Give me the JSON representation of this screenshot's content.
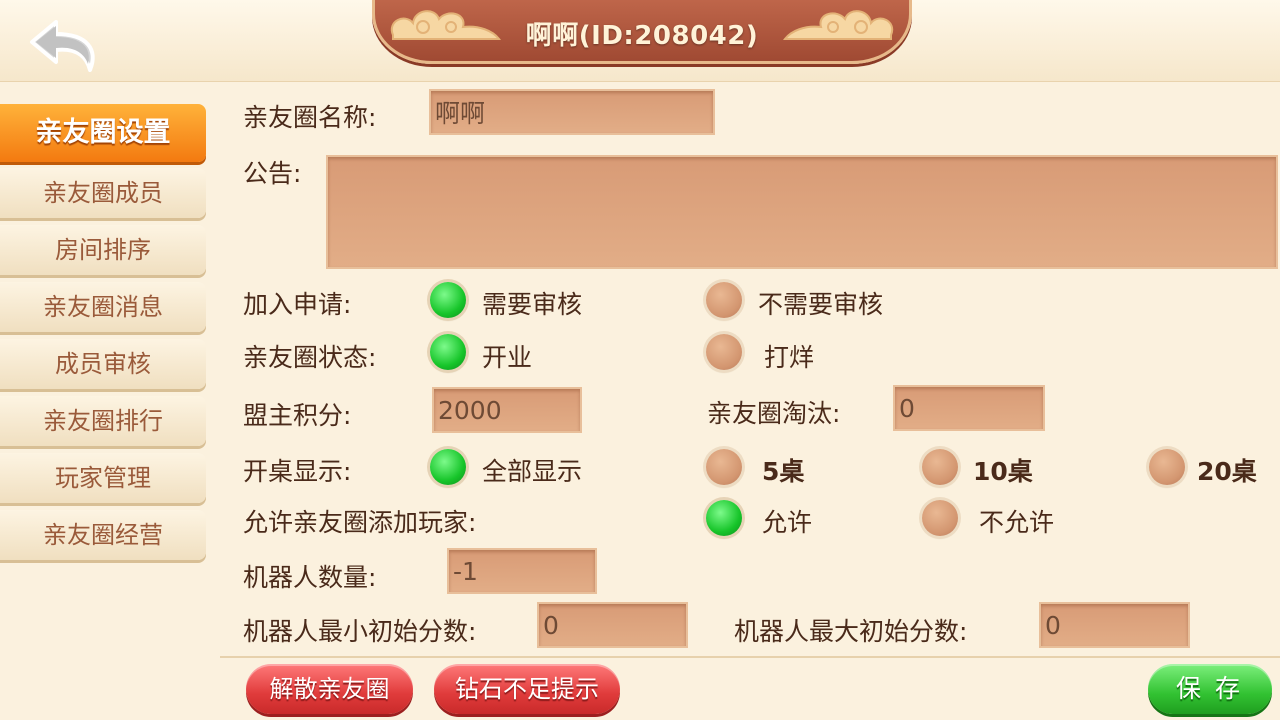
{
  "header": {
    "title": "啊啊(ID:208042)"
  },
  "sidebar": {
    "items": [
      {
        "label": "亲友圈设置",
        "active": true
      },
      {
        "label": "亲友圈成员"
      },
      {
        "label": "房间排序"
      },
      {
        "label": "亲友圈消息"
      },
      {
        "label": "成员审核"
      },
      {
        "label": "亲友圈排行"
      },
      {
        "label": "玩家管理"
      },
      {
        "label": "亲友圈经营"
      }
    ]
  },
  "form": {
    "name_label": "亲友圈名称:",
    "name_value": "啊啊",
    "notice_label": "公告:",
    "notice_value": "",
    "join_label": "加入申请:",
    "join_options": [
      "需要审核",
      "不需要审核"
    ],
    "join_selected": "需要审核",
    "status_label": "亲友圈状态:",
    "status_options": [
      "开业",
      "打烊"
    ],
    "status_selected": "开业",
    "points_label": "盟主积分:",
    "points_value": "2000",
    "eliminate_label": "亲友圈淘汰:",
    "eliminate_value": "0",
    "tables_label": "开桌显示:",
    "tables_options": [
      "全部显示",
      "5桌",
      "10桌",
      "20桌"
    ],
    "tables_selected": "全部显示",
    "allow_add_label": "允许亲友圈添加玩家:",
    "allow_add_options": [
      "允许",
      "不允许"
    ],
    "allow_add_selected": "允许",
    "robot_count_label": "机器人数量:",
    "robot_count_value": "-1",
    "robot_min_label": "机器人最小初始分数:",
    "robot_min_value": "0",
    "robot_max_label": "机器人最大初始分数:",
    "robot_max_value": "0"
  },
  "actions": {
    "dissolve": "解散亲友圈",
    "diamond_alert": "钻石不足提示",
    "save": "保存"
  },
  "colors": {
    "radio_on": "#17c52a",
    "radio_off": "#d39670",
    "active_tab": "#f37a10",
    "title_plate": "#a04a33"
  }
}
